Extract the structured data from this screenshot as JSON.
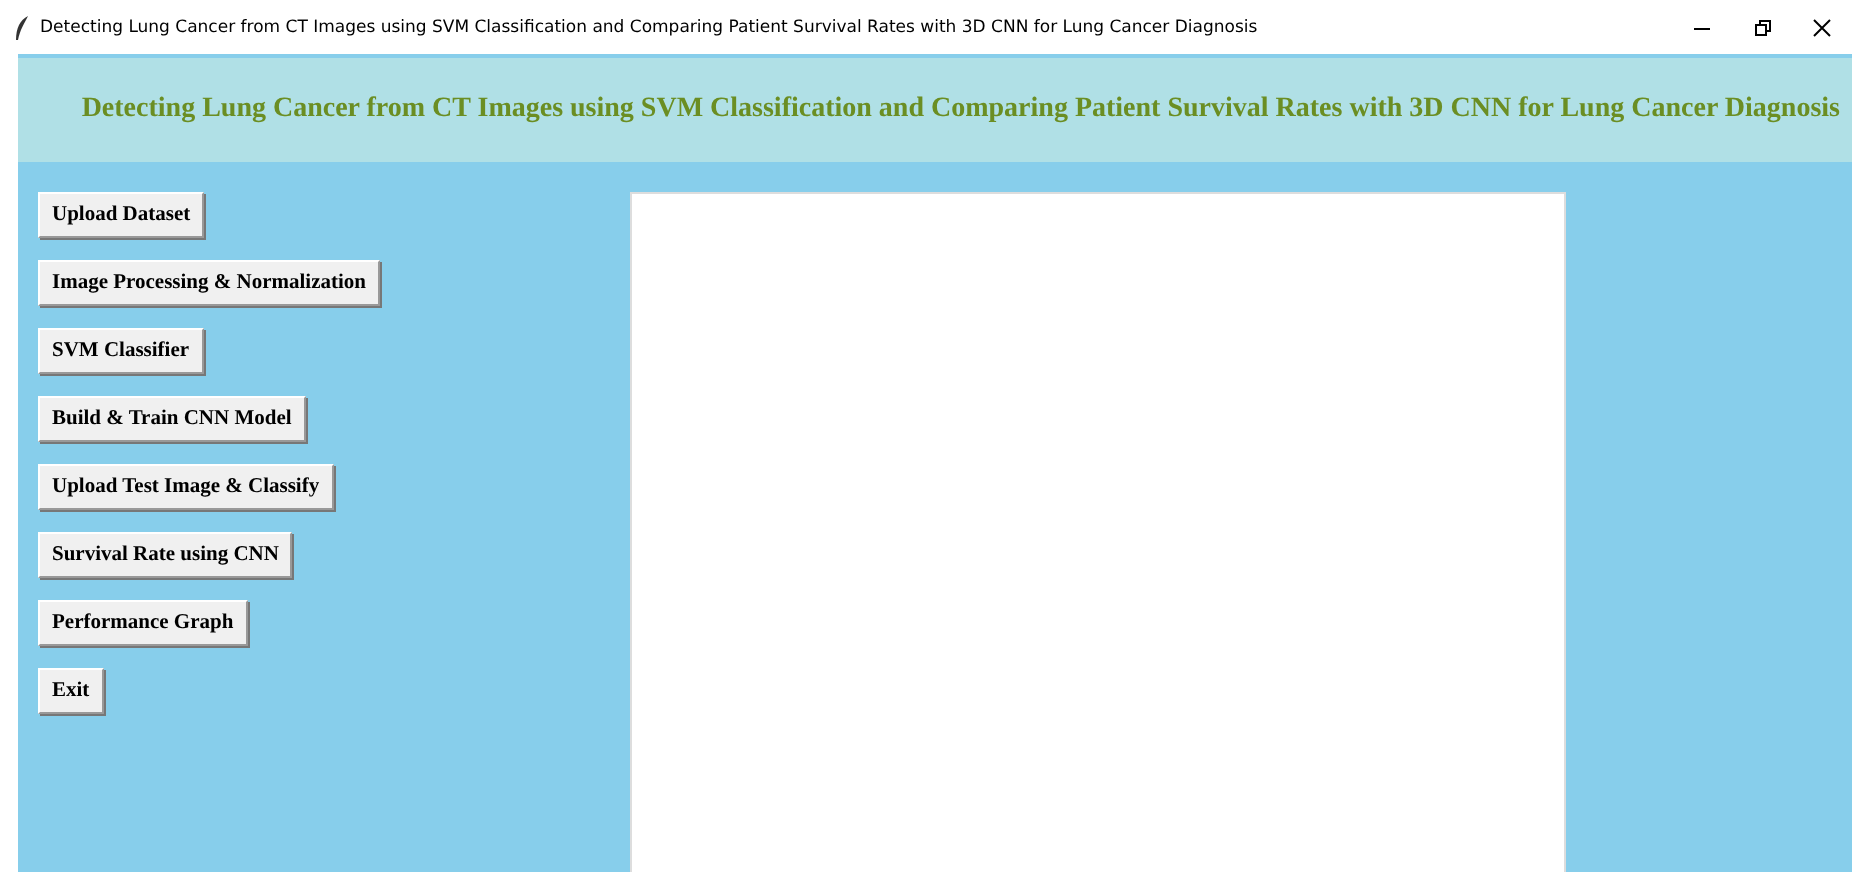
{
  "window": {
    "title": "Detecting Lung Cancer from CT Images using SVM Classification and Comparing Patient Survival Rates with 3D CNN for Lung Cancer Diagnosis"
  },
  "header": {
    "title": "Detecting Lung Cancer from CT Images using SVM Classification and Comparing Patient Survival Rates with 3D CNN for Lung Cancer Diagnosis"
  },
  "buttons": [
    "Upload Dataset",
    "Image Processing & Normalization",
    "SVM Classifier",
    "Build & Train CNN Model",
    "Upload Test Image & Classify",
    "Survival Rate using CNN",
    "Performance Graph",
    "Exit"
  ]
}
